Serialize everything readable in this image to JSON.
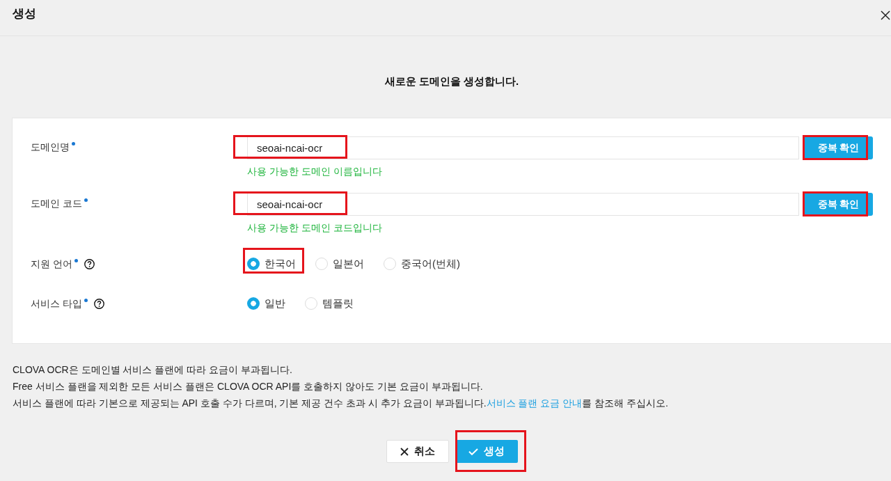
{
  "dialog": {
    "title": "생성"
  },
  "intro": "새로운 도메인을 생성합니다.",
  "form": {
    "fields": [
      {
        "kind": "text",
        "label": "도메인명",
        "required": true,
        "help": false,
        "value": "seoai-ncai-ocr",
        "highlighted": true,
        "button": {
          "label": "중복 확인",
          "highlighted": true
        },
        "message": "사용 가능한 도메인 이름입니다"
      },
      {
        "kind": "text",
        "label": "도메인 코드",
        "required": true,
        "help": false,
        "value": "seoai-ncai-ocr",
        "highlighted": true,
        "button": {
          "label": "중복 확인",
          "highlighted": true
        },
        "message": "사용 가능한 도메인 코드입니다"
      },
      {
        "kind": "radio",
        "label": "지원 언어",
        "required": true,
        "help": true,
        "options": [
          {
            "label": "한국어",
            "selected": true,
            "highlighted": true
          },
          {
            "label": "일본어",
            "selected": false,
            "highlighted": false
          },
          {
            "label": "중국어(번체)",
            "selected": false,
            "highlighted": false
          }
        ]
      },
      {
        "kind": "radio",
        "label": "서비스 타입",
        "required": true,
        "help": true,
        "options": [
          {
            "label": "일반",
            "selected": true,
            "highlighted": false
          },
          {
            "label": "템플릿",
            "selected": false,
            "highlighted": false
          }
        ]
      }
    ]
  },
  "notes": [
    {
      "text": "CLOVA OCR은 도메인별 서비스 플랜에 따라 요금이 부과됩니다."
    },
    {
      "text": "Free 서비스 플랜을 제외한 모든 서비스 플랜은 CLOVA OCR API를 호출하지 않아도 기본 요금이 부과됩니다."
    },
    {
      "text": "서비스 플랜에 따라 기본으로 제공되는 API 호출 수가 다르며, 기본 제공 건수 초과 시 추가 요금이 부과됩니다.",
      "link": "서비스 플랜 요금 안내",
      "text_after": "를 참조해 주십시오."
    }
  ],
  "buttons": [
    {
      "kind": "cancel",
      "label": "취소",
      "highlighted": false
    },
    {
      "kind": "confirm",
      "label": "생성",
      "highlighted": true
    }
  ]
}
